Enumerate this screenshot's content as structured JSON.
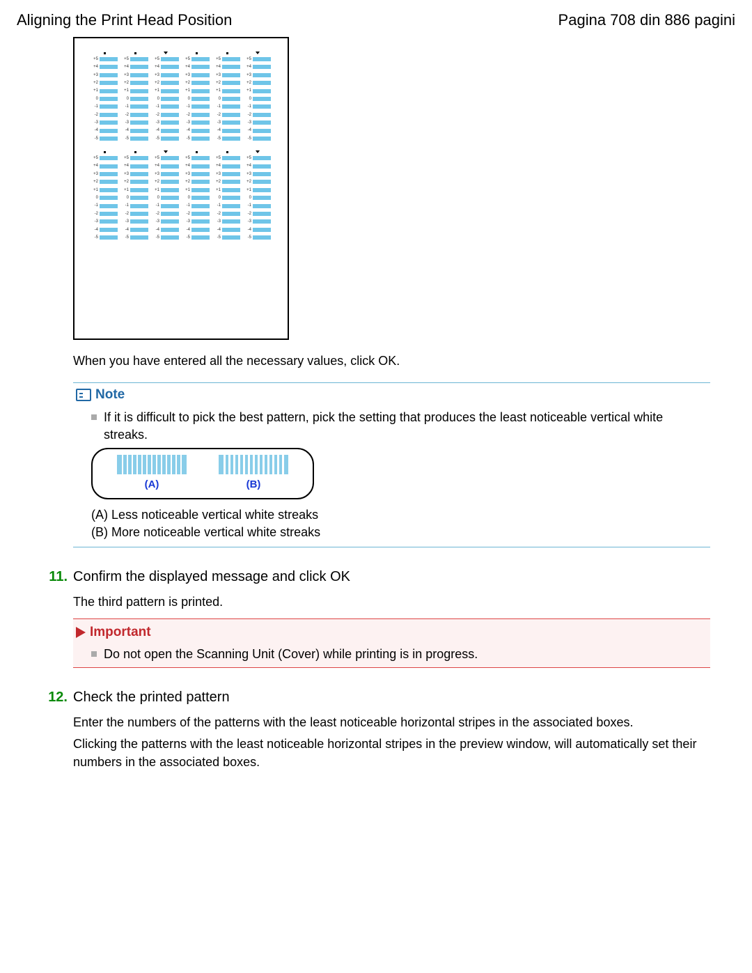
{
  "header": {
    "title": "Aligning the Print Head Position",
    "page_indicator": "Pagina 708 din 886 pagini"
  },
  "instruction_after_image": "When you have entered all the necessary values, click OK.",
  "note": {
    "label": "Note",
    "bullet": "If it is difficult to pick the best pattern, pick the setting that produces the least noticeable vertical white streaks.",
    "label_A": "(A)",
    "label_B": "(B)",
    "caption_A": "(A) Less noticeable vertical white streaks",
    "caption_B": "(B) More noticeable vertical white streaks"
  },
  "step11": {
    "num": "11.",
    "title": "Confirm the displayed message and click OK",
    "body": "The third pattern is printed."
  },
  "important": {
    "label": "Important",
    "bullet": "Do not open the Scanning Unit (Cover) while printing is in progress."
  },
  "step12": {
    "num": "12.",
    "title": "Check the printed pattern",
    "body1": "Enter the numbers of the patterns with the least noticeable horizontal stripes in the associated boxes.",
    "body2": "Clicking the patterns with the least noticeable horizontal stripes in the preview window, will automatically set their numbers in the associated boxes."
  },
  "pattern_row_labels": [
    "+5",
    "+4",
    "+3",
    "+2",
    "+1",
    "0",
    "-1",
    "-2",
    "-3",
    "-4",
    "-5"
  ]
}
